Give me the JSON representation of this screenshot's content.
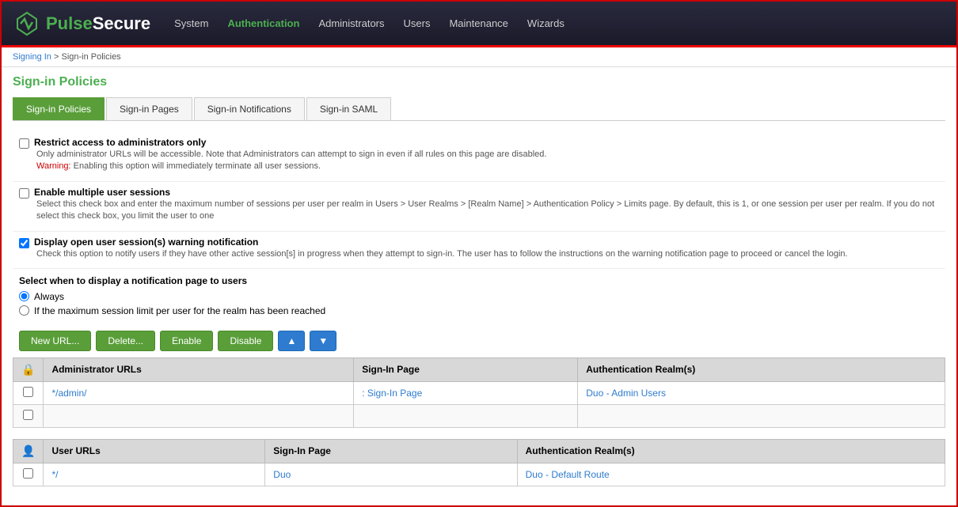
{
  "header": {
    "logo_pulse": "Pulse",
    "logo_secure": "Secure",
    "nav_items": [
      {
        "label": "System",
        "active": false
      },
      {
        "label": "Authentication",
        "active": true
      },
      {
        "label": "Administrators",
        "active": false
      },
      {
        "label": "Users",
        "active": false
      },
      {
        "label": "Maintenance",
        "active": false
      },
      {
        "label": "Wizards",
        "active": false
      }
    ]
  },
  "breadcrumb": {
    "link_text": "Signing In",
    "separator": " > ",
    "current": "Sign-in Policies"
  },
  "page": {
    "title": "Sign-in Policies",
    "tabs": [
      {
        "label": "Sign-in Policies",
        "active": true
      },
      {
        "label": "Sign-in Pages",
        "active": false
      },
      {
        "label": "Sign-in Notifications",
        "active": false
      },
      {
        "label": "Sign-in SAML",
        "active": false
      }
    ]
  },
  "options": {
    "restrict_access": {
      "label": "Restrict access to administrators only",
      "checked": false,
      "desc": "Only administrator URLs will be accessible. Note that Administrators can attempt to sign in even if all rules on this page are disabled.",
      "warning_label": "Warning:",
      "warning_text": " Enabling this option will immediately terminate all user sessions."
    },
    "enable_multiple_sessions": {
      "label": "Enable multiple user sessions",
      "checked": false,
      "desc": "Select this check box and enter the maximum number of sessions per user per realm in Users > User Realms > [Realm Name] > Authentication Policy > Limits page. By default, this is 1, or one session per user per realm. If you do not select this check box, you limit the user to one"
    },
    "display_warning": {
      "label": "Display open user session(s) warning notification",
      "checked": true,
      "desc": "Check this option to notify users if they have other active session[s] in progress when they attempt to sign-in. The user has to follow the instructions on the warning notification page to proceed or cancel the login."
    }
  },
  "notification": {
    "title": "Select when to display a notification page to users",
    "radio_options": [
      {
        "label": "Always",
        "selected": true
      },
      {
        "label": "If the maximum session limit per user for the realm has been reached",
        "selected": false
      }
    ]
  },
  "buttons": {
    "new_url": "New URL...",
    "delete": "Delete...",
    "enable": "Enable",
    "disable": "Disable",
    "up_arrow": "▲",
    "down_arrow": "▼"
  },
  "admin_table": {
    "section_icon": "lock",
    "col_urls": "Administrator URLs",
    "col_signin_page": "Sign-In Page",
    "col_auth_realm": "Authentication Realm(s)",
    "rows": [
      {
        "url": "*/admin/",
        "signin_page": ": Sign-In Page",
        "auth_realm": "Duo - Admin Users"
      }
    ]
  },
  "user_table": {
    "section_icon": "user",
    "col_urls": "User URLs",
    "col_signin_page": "Sign-In Page",
    "col_auth_realm": "Authentication Realm(s)",
    "rows": [
      {
        "url": "*/",
        "signin_page": "Duo",
        "auth_realm": "Duo - Default Route"
      }
    ]
  }
}
